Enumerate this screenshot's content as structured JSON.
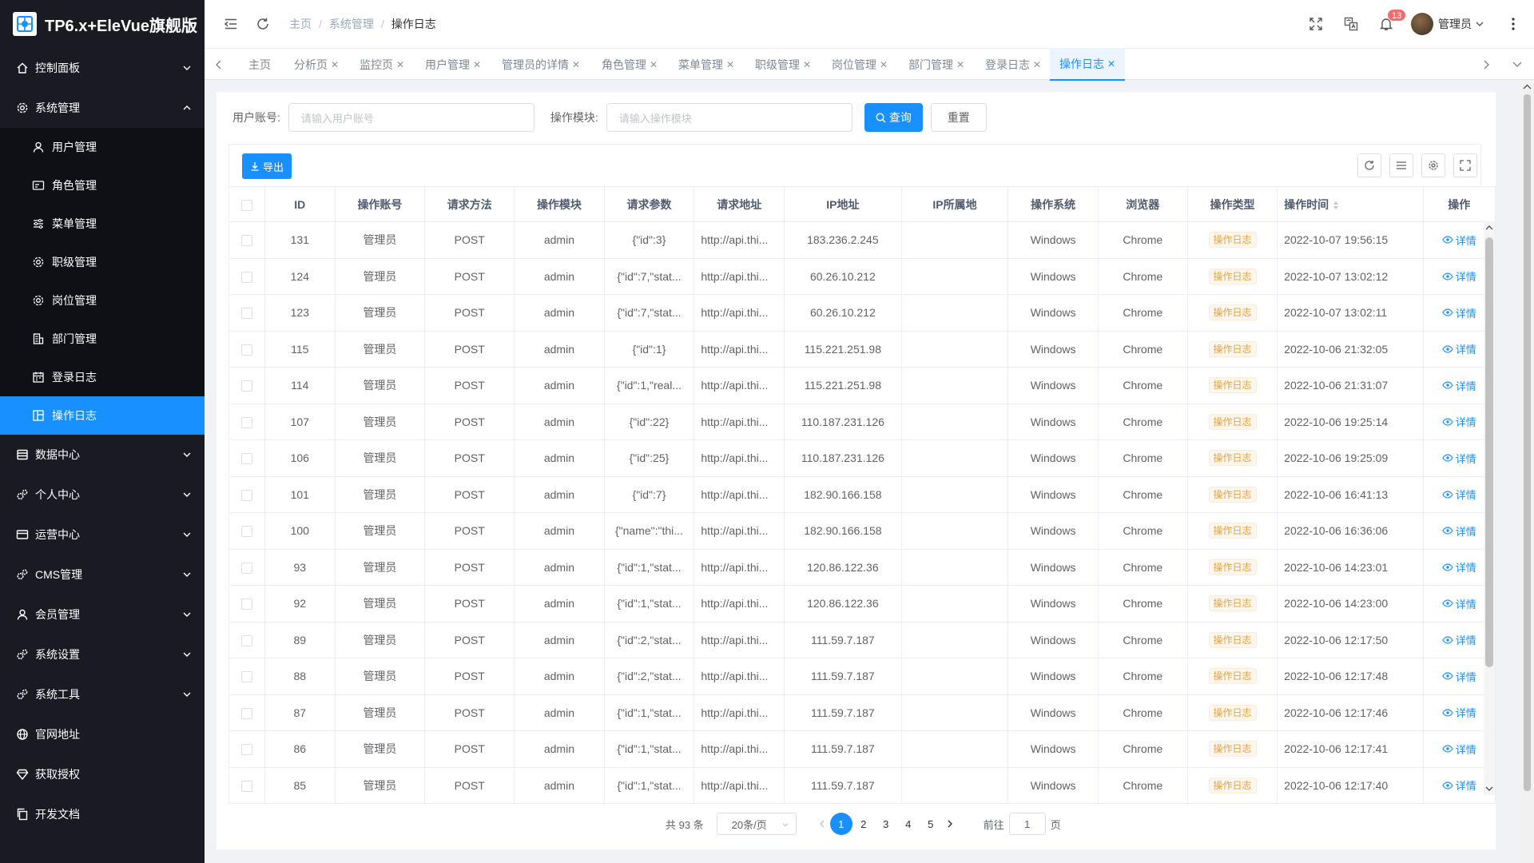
{
  "app": {
    "title": "TP6.x+EleVue旗舰版"
  },
  "sidebar": {
    "items": [
      {
        "label": "控制面板",
        "icon": "home-icon"
      },
      {
        "label": "系统管理",
        "icon": "gear-icon",
        "expanded": true
      },
      {
        "label": "数据中心",
        "icon": "database-icon"
      },
      {
        "label": "个人中心",
        "icon": "gears-icon"
      },
      {
        "label": "运营中心",
        "icon": "card-icon"
      },
      {
        "label": "CMS管理",
        "icon": "gears-icon"
      },
      {
        "label": "会员管理",
        "icon": "user-icon"
      },
      {
        "label": "系统设置",
        "icon": "gears-icon"
      },
      {
        "label": "系统工具",
        "icon": "gears-icon"
      },
      {
        "label": "官网地址",
        "icon": "globe-icon"
      },
      {
        "label": "获取授权",
        "icon": "diamond-icon"
      },
      {
        "label": "开发文档",
        "icon": "copy-icon"
      }
    ],
    "submenu": [
      {
        "label": "用户管理",
        "icon": "user-icon"
      },
      {
        "label": "角色管理",
        "icon": "id-card-icon"
      },
      {
        "label": "菜单管理",
        "icon": "sliders-icon"
      },
      {
        "label": "职级管理",
        "icon": "gear-icon"
      },
      {
        "label": "岗位管理",
        "icon": "gear-icon"
      },
      {
        "label": "部门管理",
        "icon": "building-icon"
      },
      {
        "label": "登录日志",
        "icon": "calendar-icon"
      },
      {
        "label": "操作日志",
        "icon": "layout-icon",
        "active": true
      }
    ]
  },
  "header": {
    "breadcrumb": [
      "主页",
      "系统管理",
      "操作日志"
    ],
    "notification_count": "13",
    "user_name": "管理员"
  },
  "tabs": [
    {
      "label": "主页",
      "closable": false
    },
    {
      "label": "分析页",
      "closable": true
    },
    {
      "label": "监控页",
      "closable": true
    },
    {
      "label": "用户管理",
      "closable": true
    },
    {
      "label": "管理员的详情",
      "closable": true
    },
    {
      "label": "角色管理",
      "closable": true
    },
    {
      "label": "菜单管理",
      "closable": true
    },
    {
      "label": "职级管理",
      "closable": true
    },
    {
      "label": "岗位管理",
      "closable": true
    },
    {
      "label": "部门管理",
      "closable": true
    },
    {
      "label": "登录日志",
      "closable": true
    },
    {
      "label": "操作日志",
      "closable": true,
      "active": true
    }
  ],
  "search": {
    "account_label": "用户账号:",
    "account_placeholder": "请输入用户账号",
    "module_label": "操作模块:",
    "module_placeholder": "请输入操作模块",
    "query_label": "查询",
    "reset_label": "重置"
  },
  "toolbar": {
    "export_label": "导出"
  },
  "table": {
    "columns": [
      "ID",
      "操作账号",
      "请求方法",
      "操作模块",
      "请求参数",
      "请求地址",
      "IP地址",
      "IP所属地",
      "操作系统",
      "浏览器",
      "操作类型",
      "操作时间",
      "操作"
    ],
    "detail_label": "详情",
    "rows": [
      {
        "id": "131",
        "account": "管理员",
        "method": "POST",
        "module": "admin",
        "params": "{\"id\":3}",
        "url": "http://api.thi...",
        "ip": "183.236.2.245",
        "location": "",
        "os": "Windows",
        "browser": "Chrome",
        "type": "操作日志",
        "time": "2022-10-07 19:56:15"
      },
      {
        "id": "124",
        "account": "管理员",
        "method": "POST",
        "module": "admin",
        "params": "{\"id\":7,\"stat...",
        "url": "http://api.thi...",
        "ip": "60.26.10.212",
        "location": "",
        "os": "Windows",
        "browser": "Chrome",
        "type": "操作日志",
        "time": "2022-10-07 13:02:12"
      },
      {
        "id": "123",
        "account": "管理员",
        "method": "POST",
        "module": "admin",
        "params": "{\"id\":7,\"stat...",
        "url": "http://api.thi...",
        "ip": "60.26.10.212",
        "location": "",
        "os": "Windows",
        "browser": "Chrome",
        "type": "操作日志",
        "time": "2022-10-07 13:02:11"
      },
      {
        "id": "115",
        "account": "管理员",
        "method": "POST",
        "module": "admin",
        "params": "{\"id\":1}",
        "url": "http://api.thi...",
        "ip": "115.221.251.98",
        "location": "",
        "os": "Windows",
        "browser": "Chrome",
        "type": "操作日志",
        "time": "2022-10-06 21:32:05"
      },
      {
        "id": "114",
        "account": "管理员",
        "method": "POST",
        "module": "admin",
        "params": "{\"id\":1,\"real...",
        "url": "http://api.thi...",
        "ip": "115.221.251.98",
        "location": "",
        "os": "Windows",
        "browser": "Chrome",
        "type": "操作日志",
        "time": "2022-10-06 21:31:07"
      },
      {
        "id": "107",
        "account": "管理员",
        "method": "POST",
        "module": "admin",
        "params": "{\"id\":22}",
        "url": "http://api.thi...",
        "ip": "110.187.231.126",
        "location": "",
        "os": "Windows",
        "browser": "Chrome",
        "type": "操作日志",
        "time": "2022-10-06 19:25:14"
      },
      {
        "id": "106",
        "account": "管理员",
        "method": "POST",
        "module": "admin",
        "params": "{\"id\":25}",
        "url": "http://api.thi...",
        "ip": "110.187.231.126",
        "location": "",
        "os": "Windows",
        "browser": "Chrome",
        "type": "操作日志",
        "time": "2022-10-06 19:25:09"
      },
      {
        "id": "101",
        "account": "管理员",
        "method": "POST",
        "module": "admin",
        "params": "{\"id\":7}",
        "url": "http://api.thi...",
        "ip": "182.90.166.158",
        "location": "",
        "os": "Windows",
        "browser": "Chrome",
        "type": "操作日志",
        "time": "2022-10-06 16:41:13"
      },
      {
        "id": "100",
        "account": "管理员",
        "method": "POST",
        "module": "admin",
        "params": "{\"name\":\"thi...",
        "url": "http://api.thi...",
        "ip": "182.90.166.158",
        "location": "",
        "os": "Windows",
        "browser": "Chrome",
        "type": "操作日志",
        "time": "2022-10-06 16:36:06"
      },
      {
        "id": "93",
        "account": "管理员",
        "method": "POST",
        "module": "admin",
        "params": "{\"id\":1,\"stat...",
        "url": "http://api.thi...",
        "ip": "120.86.122.36",
        "location": "",
        "os": "Windows",
        "browser": "Chrome",
        "type": "操作日志",
        "time": "2022-10-06 14:23:01"
      },
      {
        "id": "92",
        "account": "管理员",
        "method": "POST",
        "module": "admin",
        "params": "{\"id\":1,\"stat...",
        "url": "http://api.thi...",
        "ip": "120.86.122.36",
        "location": "",
        "os": "Windows",
        "browser": "Chrome",
        "type": "操作日志",
        "time": "2022-10-06 14:23:00"
      },
      {
        "id": "89",
        "account": "管理员",
        "method": "POST",
        "module": "admin",
        "params": "{\"id\":2,\"stat...",
        "url": "http://api.thi...",
        "ip": "111.59.7.187",
        "location": "",
        "os": "Windows",
        "browser": "Chrome",
        "type": "操作日志",
        "time": "2022-10-06 12:17:50"
      },
      {
        "id": "88",
        "account": "管理员",
        "method": "POST",
        "module": "admin",
        "params": "{\"id\":2,\"stat...",
        "url": "http://api.thi...",
        "ip": "111.59.7.187",
        "location": "",
        "os": "Windows",
        "browser": "Chrome",
        "type": "操作日志",
        "time": "2022-10-06 12:17:48"
      },
      {
        "id": "87",
        "account": "管理员",
        "method": "POST",
        "module": "admin",
        "params": "{\"id\":1,\"stat...",
        "url": "http://api.thi...",
        "ip": "111.59.7.187",
        "location": "",
        "os": "Windows",
        "browser": "Chrome",
        "type": "操作日志",
        "time": "2022-10-06 12:17:46"
      },
      {
        "id": "86",
        "account": "管理员",
        "method": "POST",
        "module": "admin",
        "params": "{\"id\":1,\"stat...",
        "url": "http://api.thi...",
        "ip": "111.59.7.187",
        "location": "",
        "os": "Windows",
        "browser": "Chrome",
        "type": "操作日志",
        "time": "2022-10-06 12:17:41"
      },
      {
        "id": "85",
        "account": "管理员",
        "method": "POST",
        "module": "admin",
        "params": "{\"id\":1,\"stat...",
        "url": "http://api.thi...",
        "ip": "111.59.7.187",
        "location": "",
        "os": "Windows",
        "browser": "Chrome",
        "type": "操作日志",
        "time": "2022-10-06 12:17:40"
      }
    ]
  },
  "pagination": {
    "total_text": "共 93 条",
    "page_size": "20条/页",
    "pages": [
      "1",
      "2",
      "3",
      "4",
      "5"
    ],
    "current": "1",
    "goto_prefix": "前往",
    "goto_value": "1",
    "goto_suffix": "页"
  },
  "colors": {
    "primary": "#1890ff",
    "sidebar_bg": "#191a23",
    "tag_warning": "#e6a23c",
    "badge": "#f56c6c"
  }
}
